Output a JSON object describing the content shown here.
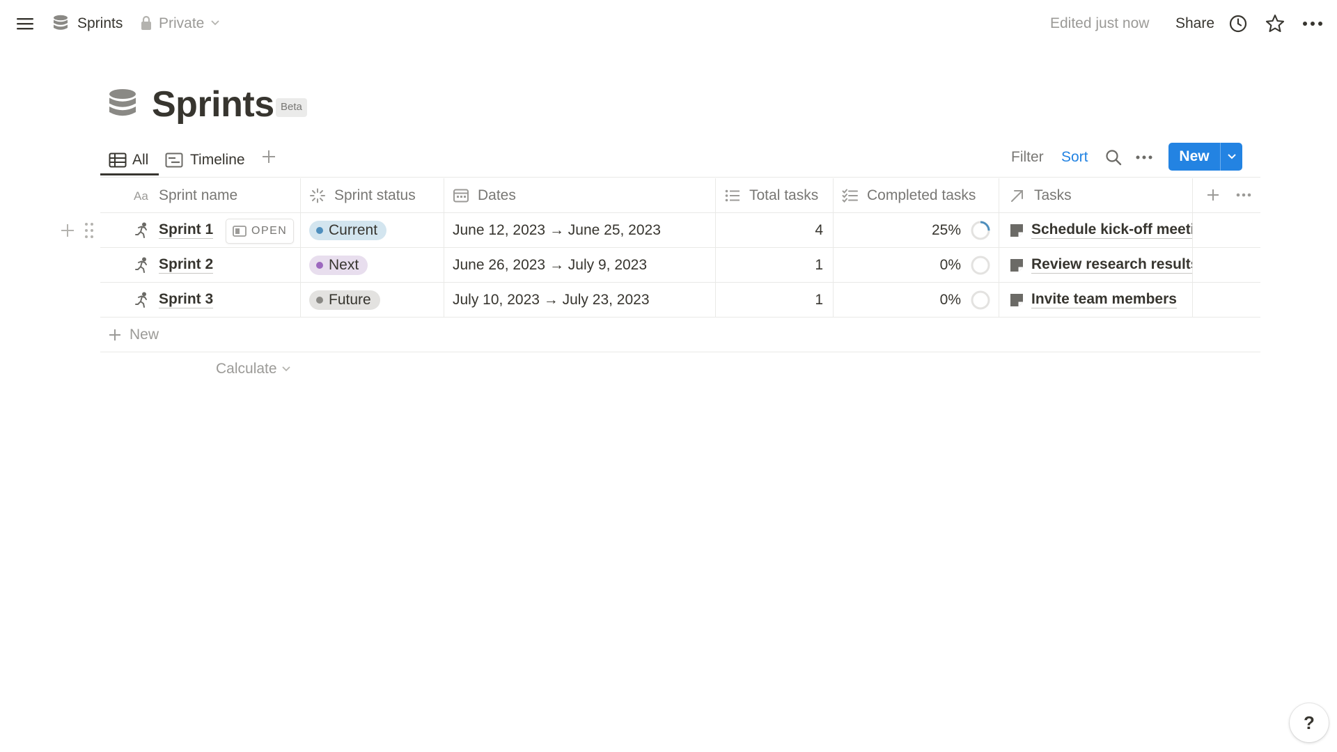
{
  "topbar": {
    "breadcrumb_title": "Sprints",
    "privacy": "Private",
    "edited": "Edited just now",
    "share": "Share",
    "icons": [
      "menu-icon",
      "database-icon",
      "lock-icon",
      "chevron-down-icon",
      "clock-icon",
      "star-icon",
      "more-icon"
    ]
  },
  "page": {
    "title": "Sprints",
    "badge": "Beta"
  },
  "views": {
    "tabs": [
      {
        "label": "All",
        "icon": "table-icon",
        "active": true
      },
      {
        "label": "Timeline",
        "icon": "timeline-icon",
        "active": false
      }
    ],
    "filter": "Filter",
    "sort": "Sort",
    "new_button": "New",
    "accent": "#2383e2"
  },
  "table": {
    "columns": [
      {
        "label": "Sprint name",
        "icon": "text-type-icon"
      },
      {
        "label": "Sprint status",
        "icon": "status-icon"
      },
      {
        "label": "Dates",
        "icon": "calendar-icon"
      },
      {
        "label": "Total tasks",
        "icon": "list-icon"
      },
      {
        "label": "Completed tasks",
        "icon": "checklist-icon"
      },
      {
        "label": "Tasks",
        "icon": "relation-arrow-icon"
      }
    ],
    "open_label": "OPEN",
    "rows": [
      {
        "name": "Sprint 1",
        "status": "Current",
        "dates": "June 12, 2023 → June 25, 2023",
        "total": "4",
        "completed": "25%",
        "completed_fraction": 0.25,
        "task": "Schedule kick-off meeting"
      },
      {
        "name": "Sprint 2",
        "status": "Next",
        "dates": "June 26, 2023 → July 9, 2023",
        "total": "1",
        "completed": "0%",
        "completed_fraction": 0,
        "task": "Review research results"
      },
      {
        "name": "Sprint 3",
        "status": "Future",
        "dates": "July 10, 2023 → July 23, 2023",
        "total": "1",
        "completed": "0%",
        "completed_fraction": 0,
        "task": "Invite team members"
      }
    ],
    "new_row_label": "New",
    "calculate": "Calculate",
    "status_colors": {
      "Current": "#d3e5ef",
      "Next": "#e8deee",
      "Future": "#e3e2e0"
    }
  },
  "help": {
    "label": "?"
  }
}
